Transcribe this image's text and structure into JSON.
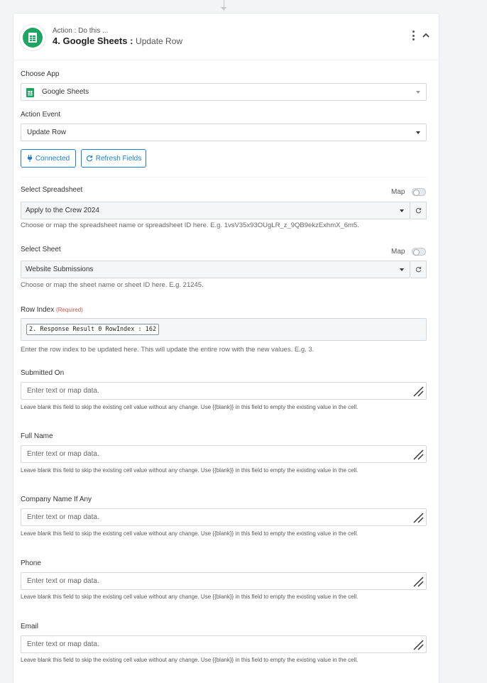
{
  "step": {
    "kicker": "Action : Do this ...",
    "title_main": "4. Google Sheets : ",
    "title_sub": "Update Row"
  },
  "choose_app": {
    "label": "Choose App",
    "value": "Google Sheets"
  },
  "action_event": {
    "label": "Action Event",
    "value": "Update Row"
  },
  "buttons": {
    "connected": "Connected",
    "refresh_fields": "Refresh Fields"
  },
  "map_label": "Map",
  "spreadsheet": {
    "label": "Select Spreadsheet",
    "value": "Apply to the Crew 2024",
    "help": "Choose or map the spreadsheet name or spreadsheet ID here. E.g. 1vsV35x93OUgLR_z_9QB9ekzExhmX_6m5."
  },
  "sheet": {
    "label": "Select Sheet",
    "value": "Website Submissions",
    "help": "Choose or map the sheet name or sheet ID here. E.g. 21245."
  },
  "row_index": {
    "label": "Row Index",
    "required": "(Required)",
    "chip": "2. Response Result 0 RowIndex : 162",
    "help": "Enter the row index to be updated here. This will update the entire row with the new values. E.g. 3."
  },
  "fields": [
    {
      "label": "Submitted On",
      "placeholder": "Enter text or map data."
    },
    {
      "label": "Full Name",
      "placeholder": "Enter text or map data."
    },
    {
      "label": "Company Name If Any",
      "placeholder": "Enter text or map data."
    },
    {
      "label": "Phone",
      "placeholder": "Enter text or map data."
    },
    {
      "label": "Email",
      "placeholder": "Enter text or map data."
    }
  ],
  "field_help": "Leave blank this field to skip the existing cell value without any change. Use {{blank}} in this field to empty the existing value in the cell.",
  "colors": {
    "accent": "#1a7fd4",
    "sheets_green": "#20a464",
    "required": "#d9534f"
  },
  "icons": [
    "google-sheets-icon",
    "kebab-menu-icon",
    "chevron-up-icon",
    "caret-down-icon",
    "plug-icon",
    "refresh-icon",
    "expand-textarea-icon"
  ]
}
